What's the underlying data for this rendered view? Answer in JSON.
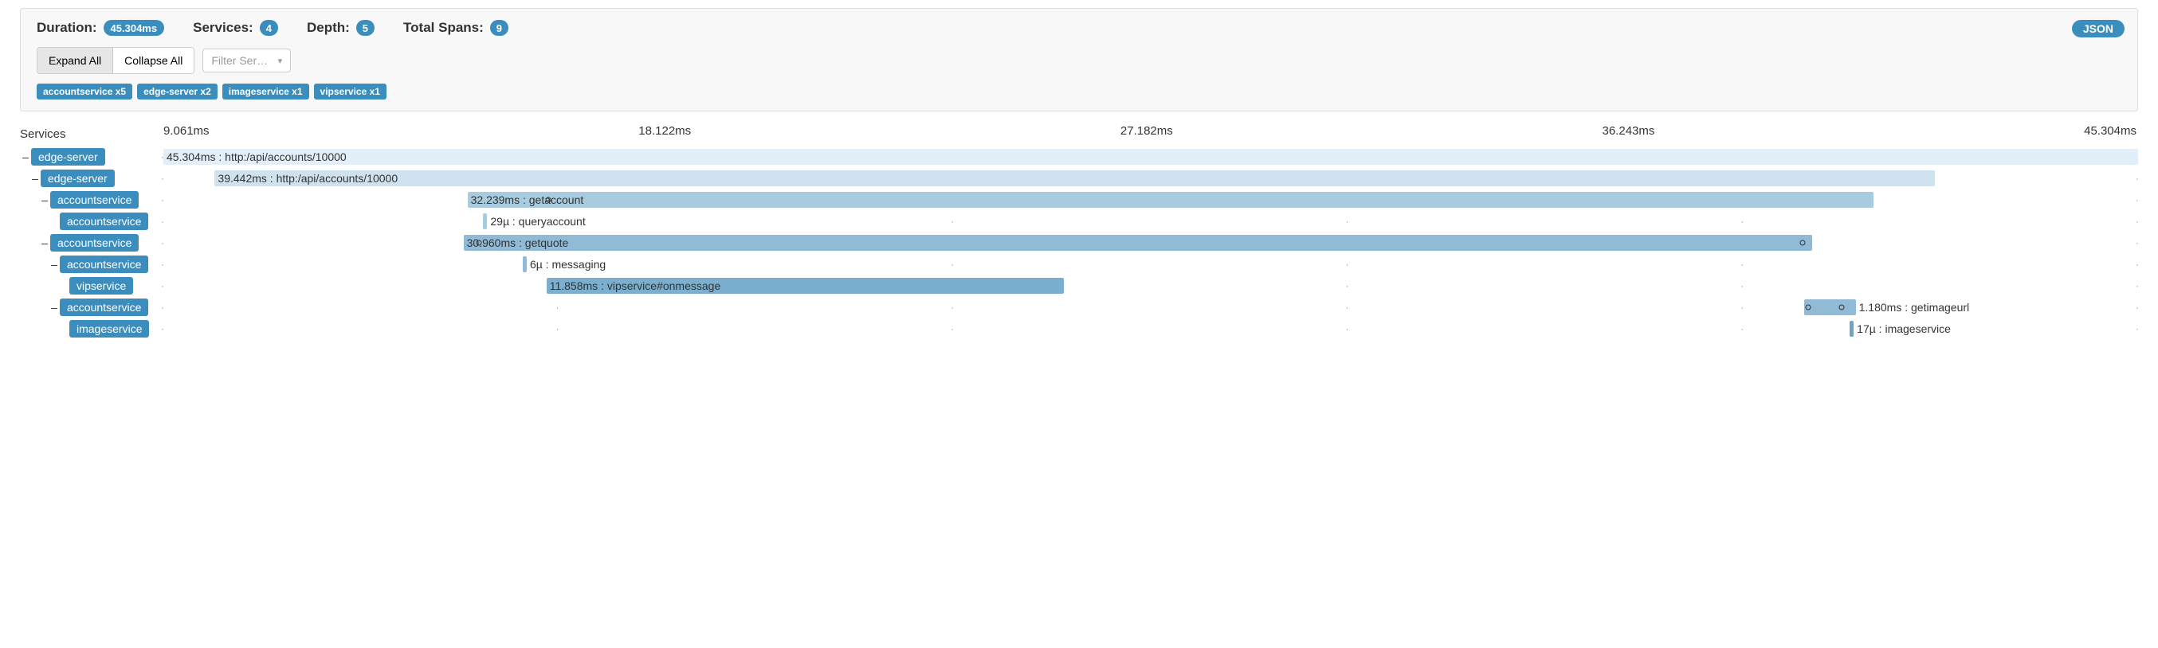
{
  "summary": {
    "duration_label": "Duration:",
    "duration_value": "45.304ms",
    "services_label": "Services:",
    "services_value": "4",
    "depth_label": "Depth:",
    "depth_value": "5",
    "total_spans_label": "Total Spans:",
    "total_spans_value": "9",
    "json_button": "JSON"
  },
  "controls": {
    "expand_all": "Expand All",
    "collapse_all": "Collapse All",
    "filter_placeholder": "Filter Ser…"
  },
  "tags": [
    "accountservice x5",
    "edge-server x2",
    "imageservice x1",
    "vipservice x1"
  ],
  "left_header": "Services",
  "axis": [
    "9.061ms",
    "18.122ms",
    "27.182ms",
    "36.243ms",
    "45.304ms"
  ],
  "services_col": [
    {
      "toggle": "–",
      "indent": 0,
      "label": "edge-server"
    },
    {
      "toggle": "–",
      "indent": 1,
      "label": "edge-server"
    },
    {
      "toggle": "–",
      "indent": 2,
      "label": "accountservice"
    },
    {
      "toggle": "",
      "indent": 3,
      "label": "accountservice"
    },
    {
      "toggle": "–",
      "indent": 2,
      "label": "accountservice"
    },
    {
      "toggle": "–",
      "indent": 3,
      "label": "accountservice"
    },
    {
      "toggle": "",
      "indent": 4,
      "label": "vipservice"
    },
    {
      "toggle": "–",
      "indent": 3,
      "label": "accountservice"
    },
    {
      "toggle": "",
      "indent": 4,
      "label": "imageservice"
    }
  ],
  "spans": [
    {
      "start_pct": 0.0,
      "width_pct": 100.0,
      "color": "c0",
      "label": "45.304ms : http:/api/accounts/10000",
      "label_out": false
    },
    {
      "start_pct": 2.6,
      "width_pct": 87.1,
      "color": "c1",
      "label": "39.442ms : http:/api/accounts/10000",
      "label_out": false
    },
    {
      "start_pct": 15.4,
      "width_pct": 71.2,
      "color": "c2",
      "label": "32.239ms : getaccount",
      "label_out": false,
      "markers_pct": [
        19.5
      ]
    },
    {
      "start_pct": 16.2,
      "width_pct": 0.2,
      "color": "c2",
      "label": "29µ : queryaccount",
      "label_out": true
    },
    {
      "start_pct": 15.2,
      "width_pct": 68.3,
      "color": "c3",
      "label": "30.960ms : getquote",
      "label_out": false,
      "markers_pct": [
        16.0,
        83.0
      ]
    },
    {
      "start_pct": 18.2,
      "width_pct": 0.2,
      "color": "c3",
      "label": "6µ : messaging",
      "label_out": true
    },
    {
      "start_pct": 19.4,
      "width_pct": 26.2,
      "color": "c4",
      "label": "11.858ms : vipservice#onmessage",
      "label_out": false
    },
    {
      "start_pct": 83.1,
      "width_pct": 2.6,
      "color": "c3",
      "label": "1.180ms : getimageurl",
      "label_out": true,
      "markers_pct": [
        83.3,
        85.0
      ]
    },
    {
      "start_pct": 85.4,
      "width_pct": 0.2,
      "color": "c5",
      "label": "17µ : imageservice",
      "label_out": true
    }
  ],
  "tick_char": "·",
  "chart_data": {
    "type": "trace-timeline",
    "total_duration_ms": 45.304,
    "spans": [
      {
        "service": "edge-server",
        "operation": "http:/api/accounts/10000",
        "start_ms": 0.0,
        "duration_ms": 45.304,
        "depth": 0
      },
      {
        "service": "edge-server",
        "operation": "http:/api/accounts/10000",
        "start_ms": 1.18,
        "duration_ms": 39.442,
        "depth": 1
      },
      {
        "service": "accountservice",
        "operation": "getaccount",
        "start_ms": 6.98,
        "duration_ms": 32.239,
        "depth": 2
      },
      {
        "service": "accountservice",
        "operation": "queryaccount",
        "start_ms": 7.34,
        "duration_ms": 0.029,
        "depth": 3
      },
      {
        "service": "accountservice",
        "operation": "getquote",
        "start_ms": 6.89,
        "duration_ms": 30.96,
        "depth": 2
      },
      {
        "service": "accountservice",
        "operation": "messaging",
        "start_ms": 8.25,
        "duration_ms": 0.006,
        "depth": 3
      },
      {
        "service": "vipservice",
        "operation": "vipservice#onmessage",
        "start_ms": 8.79,
        "duration_ms": 11.858,
        "depth": 4
      },
      {
        "service": "accountservice",
        "operation": "getimageurl",
        "start_ms": 37.65,
        "duration_ms": 1.18,
        "depth": 3
      },
      {
        "service": "imageservice",
        "operation": "imageservice",
        "start_ms": 38.69,
        "duration_ms": 0.017,
        "depth": 4
      }
    ]
  }
}
